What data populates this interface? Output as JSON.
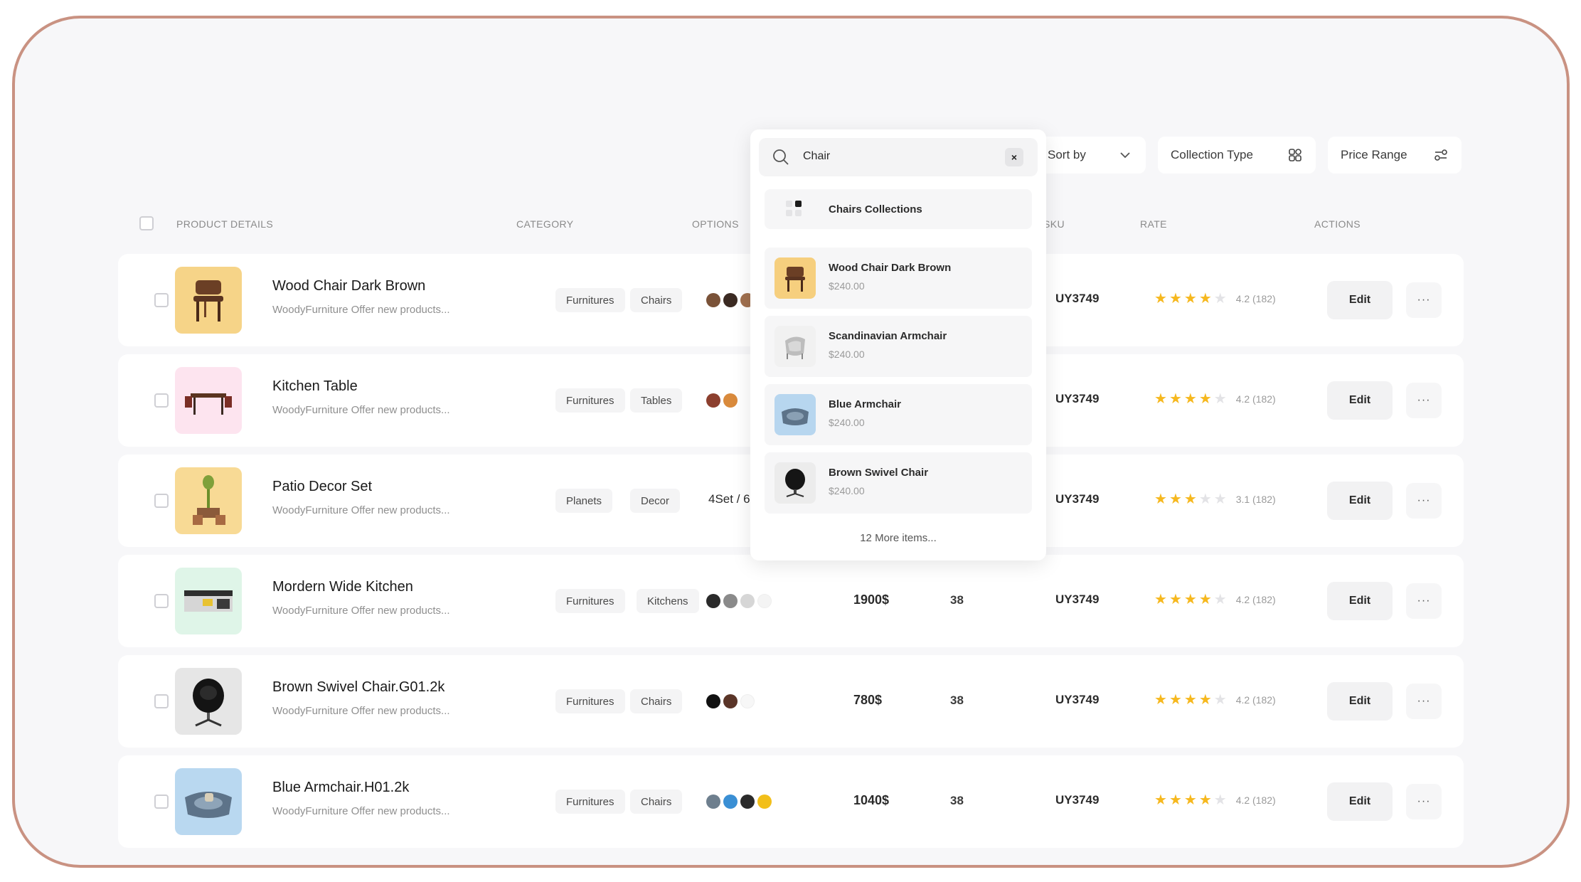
{
  "toolbar": {
    "sort_label": "Sort by",
    "collection_label": "Collection Type",
    "price_label": "Price Range"
  },
  "search": {
    "query": "Chair",
    "clear_icon": "close-icon",
    "collection_label": "Chairs Collections",
    "results": [
      {
        "name": "Wood Chair Dark Brown",
        "price": "$240.00"
      },
      {
        "name": "Scandinavian Armchair",
        "price": "$240.00"
      },
      {
        "name": "Blue Armchair",
        "price": "$240.00"
      },
      {
        "name": "Brown Swivel Chair",
        "price": "$240.00"
      }
    ],
    "more_label": "12 More items..."
  },
  "table": {
    "headers": {
      "product": "PRODUCT DETAILS",
      "category": "CATEGORY",
      "options": "OPTIONS",
      "sku": "SKU",
      "rate": "RATE",
      "actions": "ACTIONS"
    },
    "edit_label": "Edit",
    "more_label": "···",
    "rows": [
      {
        "name": "Wood Chair Dark Brown",
        "desc": "WoodyFurniture Offer new products...",
        "tags": [
          "Furnitures",
          "Chairs"
        ],
        "colors": [
          "#7a5238",
          "#3b2a22",
          "#a0704f"
        ],
        "options_text": "",
        "price": "",
        "stock": "",
        "sku": "UY3749",
        "stars": 4,
        "rating": "4.2 (182)"
      },
      {
        "name": "Kitchen Table",
        "desc": "WoodyFurniture Offer new products...",
        "tags": [
          "Furnitures",
          "Tables"
        ],
        "colors": [
          "#8c3f2e",
          "#d98a3c"
        ],
        "options_text": "",
        "price": "",
        "stock": "",
        "sku": "UY3749",
        "stars": 4,
        "rating": "4.2 (182)"
      },
      {
        "name": "Patio Decor Set",
        "desc": "WoodyFurniture Offer new products...",
        "tags": [
          "Planets",
          "Decor"
        ],
        "colors": [],
        "options_text": "4Set / 6",
        "price": "",
        "stock": "",
        "sku": "UY3749",
        "stars": 3,
        "rating": "3.1 (182)"
      },
      {
        "name": "Mordern Wide Kitchen",
        "desc": "WoodyFurniture Offer new products...",
        "tags": [
          "Furnitures",
          "Kitchens"
        ],
        "colors": [
          "#2a2a2a",
          "#8a8a8a",
          "#d6d6d6",
          "#f4f4f4"
        ],
        "options_text": "",
        "price": "1900$",
        "stock": "38",
        "sku": "UY3749",
        "stars": 4,
        "rating": "4.2 (182)"
      },
      {
        "name": "Brown Swivel Chair.G01.2k",
        "desc": "WoodyFurniture Offer new products...",
        "tags": [
          "Furnitures",
          "Chairs"
        ],
        "colors": [
          "#111111",
          "#5a3528",
          "#f7f7f7"
        ],
        "options_text": "",
        "price": "780$",
        "stock": "38",
        "sku": "UY3749",
        "stars": 4,
        "rating": "4.2 (182)"
      },
      {
        "name": "Blue Armchair.H01.2k",
        "desc": "WoodyFurniture Offer new products...",
        "tags": [
          "Furnitures",
          "Chairs"
        ],
        "colors": [
          "#6e7f8e",
          "#3a8fd4",
          "#2b2b2b",
          "#f2bf1a"
        ],
        "options_text": "",
        "price": "1040$",
        "stock": "38",
        "sku": "UY3749",
        "stars": 4,
        "rating": "4.2 (182)"
      }
    ]
  },
  "colors": {
    "star_filled": "#f6b81e",
    "star_empty": "#e3e3e6",
    "frame_border": "#c99282"
  }
}
